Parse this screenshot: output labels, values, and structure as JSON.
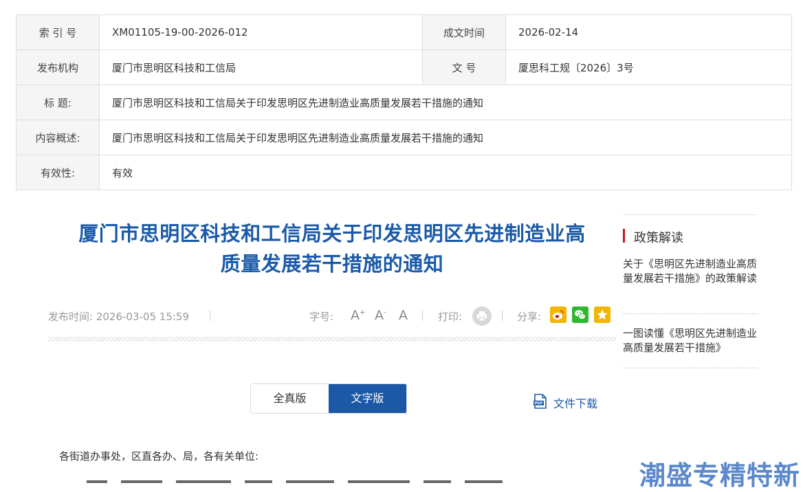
{
  "meta_table": {
    "index_label": "索 引 号",
    "index_value": "XM01105-19-00-2026-012",
    "date_label": "成文时间",
    "date_value": "2026-02-14",
    "org_label": "发布机构",
    "org_value": "厦门市思明区科技和工信局",
    "docno_label": "文 号",
    "docno_value": "厦思科工规〔2026〕3号",
    "title_label": "标 题:",
    "title_value": "厦门市思明区科技和工信局关于印发思明区先进制造业高质量发展若干措施的通知",
    "summary_label": "内容概述:",
    "summary_value": "厦门市思明区科技和工信局关于印发思明区先进制造业高质量发展若干措施的通知",
    "validity_label": "有效性:",
    "validity_value": "有效"
  },
  "article": {
    "title_line1": "厦门市思明区科技和工信局关于印发思明区先进制造业高",
    "title_line2": "质量发展若干措施的通知",
    "publish_label": "发布时间:",
    "publish_time": "2026-03-05 15:59",
    "font_size_label": "字号:",
    "font_large": "A",
    "font_large_mark": "+",
    "font_small": "A",
    "font_small_mark": "-",
    "font_default": "A",
    "print_label": "打印:",
    "share_label": "分享:",
    "salutation": "各街道办事处，区直各办、局，各有关单位:"
  },
  "tabs": {
    "full_version": "全真版",
    "text_version": "文字版"
  },
  "download": {
    "label": "文件下载"
  },
  "sidebar": {
    "heading": "政策解读",
    "item1": "关于《思明区先进制造业高质量发展若干措施》的政策解读",
    "item2": "一图读懂《思明区先进制造业高质量发展若干措施》"
  },
  "watermark": "潮盛专精特新",
  "colors": {
    "title_blue": "#1a5aa8",
    "tab_active": "#1b58a5",
    "sidebar_accent": "#c8161d",
    "weibo": "#f2b600",
    "wechat": "#2fb72f",
    "favorite": "#f2b600"
  }
}
